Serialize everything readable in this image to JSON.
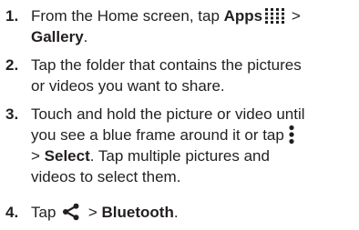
{
  "steps": [
    {
      "number": "1.",
      "line1_text": "From the Home screen, tap ",
      "line1_bold": "Apps",
      "line1_after": " >",
      "line2_bold": "Gallery",
      "line2_after": ".",
      "icon": "apps-grid-icon"
    },
    {
      "number": "2.",
      "line1_text": "Tap the folder that contains the pictures",
      "line2_text": "or videos you want to share."
    },
    {
      "number": "3.",
      "line1_text": "Touch and hold the picture or video until",
      "line2_text": "you see a blue frame around it or tap",
      "line3_prefix": "> ",
      "line3_bold": "Select",
      "line3_after": ". Tap multiple pictures and",
      "line4_text": "videos to select them.",
      "icon": "overflow-menu-icon"
    },
    {
      "number": "4.",
      "line1_text": "Tap ",
      "line1_after": " > ",
      "line1_bold": "Bluetooth",
      "line1_end": ".",
      "icon": "share-icon"
    }
  ],
  "colors": {
    "text": "#231f20",
    "icon": "#231f20"
  }
}
